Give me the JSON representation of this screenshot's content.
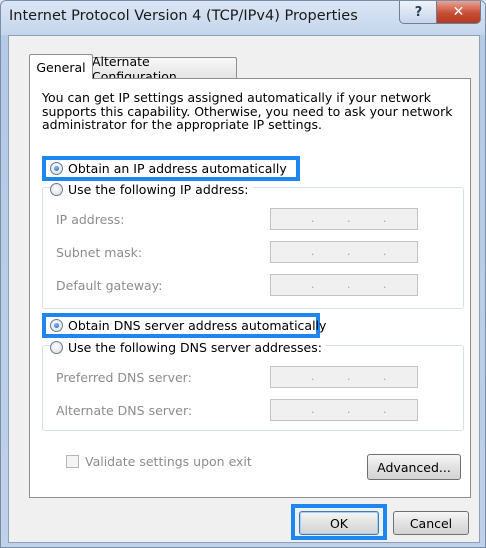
{
  "window": {
    "title": "Internet Protocol Version 4 (TCP/IPv4) Properties",
    "help_glyph": "?",
    "close_glyph": "✕"
  },
  "tabs": [
    {
      "label": "General",
      "selected": true
    },
    {
      "label": "Alternate Configuration",
      "selected": false
    }
  ],
  "general": {
    "description": "You can get IP settings assigned automatically if your network supports this capability. Otherwise, you need to ask your network administrator for the appropriate IP settings.",
    "ip_auto_label": "Obtain an IP address automatically",
    "ip_manual_label": "Use the following IP address:",
    "ip_fields": [
      {
        "label": "IP address:"
      },
      {
        "label": "Subnet mask:"
      },
      {
        "label": "Default gateway:"
      }
    ],
    "dns_auto_label": "Obtain DNS server address automatically",
    "dns_manual_label": "Use the following DNS server addresses:",
    "dns_fields": [
      {
        "label": "Preferred DNS server:"
      },
      {
        "label": "Alternate DNS server:"
      }
    ],
    "ip_dot": ".",
    "validate_label": "Validate settings upon exit",
    "advanced_label": "Advanced..."
  },
  "footer": {
    "ok_label": "OK",
    "cancel_label": "Cancel"
  },
  "colors": {
    "highlight": "#1e86f0",
    "close_button": "#c74e35"
  }
}
